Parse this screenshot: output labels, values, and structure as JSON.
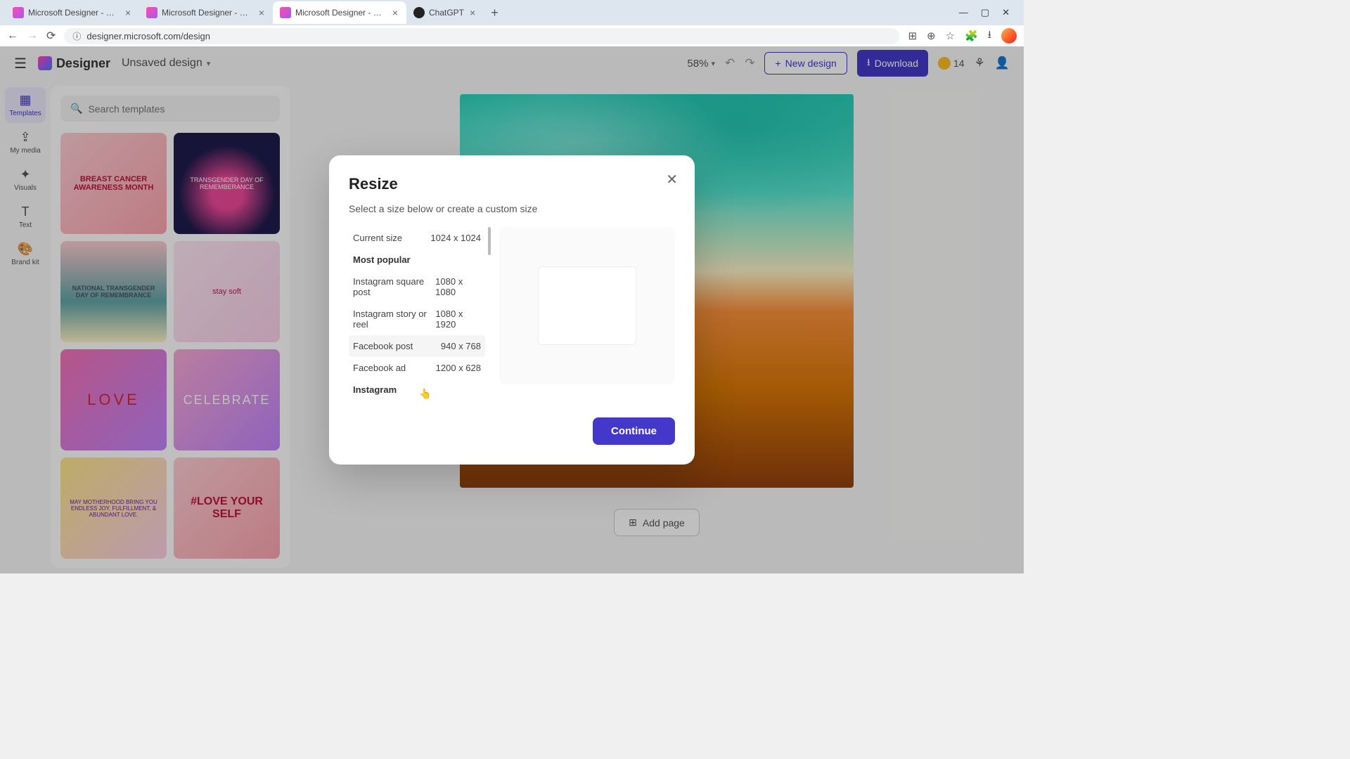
{
  "browser": {
    "tabs": [
      {
        "title": "Microsoft Designer - Stunning"
      },
      {
        "title": "Microsoft Designer - Stunning"
      },
      {
        "title": "Microsoft Designer - Stunning"
      },
      {
        "title": "ChatGPT"
      }
    ],
    "url": "designer.microsoft.com/design"
  },
  "header": {
    "logo": "Designer",
    "doc_name": "Unsaved design",
    "zoom": "58%",
    "new_design": "New design",
    "download": "Download",
    "credits": "14"
  },
  "rail": {
    "items": [
      "Templates",
      "My media",
      "Visuals",
      "Text",
      "Brand kit"
    ]
  },
  "sidebar": {
    "search_placeholder": "Search templates",
    "templates": [
      "BREAST CANCER AWARENESS MONTH",
      "TRANSGENDER DAY OF REMEMBERANCE",
      "NATIONAL TRANSGENDER DAY OF REMEMBRANCE",
      "stay soft",
      "LOVE",
      "CELEBRATE",
      "MAY MOTHERHOOD BRING YOU ENDLESS JOY, FULFILLMENT, & ABUNDANT LOVE.",
      "#LOVE YOUR SELF"
    ]
  },
  "canvas": {
    "add_page": "Add page"
  },
  "modal": {
    "title": "Resize",
    "subtitle": "Select a size below or create a custom size",
    "current_label": "Current size",
    "current_value": "1024 x 1024",
    "heading_popular": "Most popular",
    "sizes": [
      {
        "name": "Instagram square post",
        "dim": "1080 x 1080"
      },
      {
        "name": "Instagram story or reel",
        "dim": "1080 x 1920"
      },
      {
        "name": "Facebook post",
        "dim": "940 x 768"
      },
      {
        "name": "Facebook ad",
        "dim": "1200 x 628"
      }
    ],
    "heading_instagram": "Instagram",
    "continue": "Continue"
  }
}
